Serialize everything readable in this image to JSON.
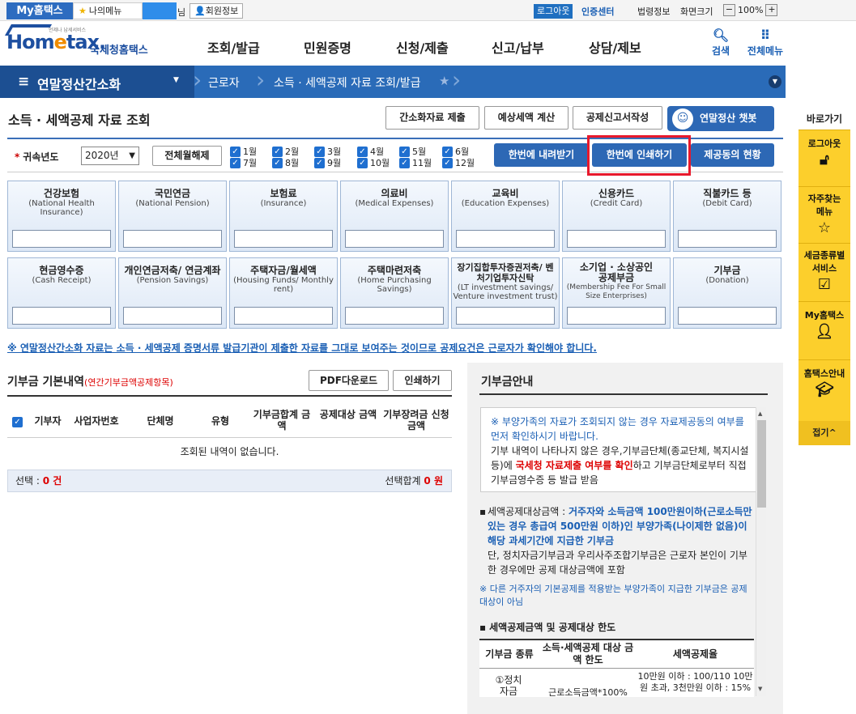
{
  "topbar": {
    "myhome": "My홈택스",
    "mymenu": "나의메뉴",
    "nim": "님",
    "member_info": "회원정보",
    "logout": "로그아웃",
    "cert_center": "인증센터",
    "law_info": "법령정보",
    "screen_size": "화면크기",
    "zoom_minus": "−",
    "zoom": "100%",
    "zoom_plus": "+"
  },
  "logo": {
    "small": "언제나 납세서비스",
    "brand_a": "Hom",
    "brand_b": "e",
    "brand_c": "tax.",
    "brand_kr": "국세청홈택스"
  },
  "gnb": [
    "조회/발급",
    "민원증명",
    "신청/제출",
    "신고/납부",
    "상담/제보"
  ],
  "nav": {
    "search": "검색",
    "all_menu": "전체메뉴"
  },
  "bluebar": {
    "title": "연말정산간소화",
    "crumb1": "근로자",
    "crumb2": "소득 · 세액공제 자료 조회/발급"
  },
  "quick": {
    "title": "바로가기",
    "items": [
      "로그아웃",
      "자주찾는 메뉴",
      "세금종류별 서비스",
      "My홈택스",
      "홈택스안내"
    ],
    "fold": "접기^"
  },
  "page": {
    "title": "소득 · 세액공제 자료 조회",
    "btn_submit": "간소화자료 제출",
    "btn_estimate": "예상세액 계산",
    "btn_report": "공제신고서작성",
    "btn_chatbot": "연말정산 챗봇"
  },
  "filter": {
    "year_label": "귀속년도",
    "required": "*",
    "year_value": "2020년",
    "clear_all": "전체월해제",
    "months": [
      "1월",
      "2월",
      "3월",
      "4월",
      "5월",
      "6월",
      "7월",
      "8월",
      "9월",
      "10월",
      "11월",
      "12월"
    ],
    "download_all": "한번에 내려받기",
    "print_all": "한번에 인쇄하기",
    "agree_status": "제공동의 현황"
  },
  "cards_row1": [
    {
      "kr": "건강보험",
      "en": "(National Health Insurance)"
    },
    {
      "kr": "국민연금",
      "en": "(National Pension)"
    },
    {
      "kr": "보험료",
      "en": "(Insurance)"
    },
    {
      "kr": "의료비",
      "en": "(Medical Expenses)"
    },
    {
      "kr": "교육비",
      "en": "(Education Expenses)"
    },
    {
      "kr": "신용카드",
      "en": "(Credit Card)"
    },
    {
      "kr": "직불카드 등",
      "en": "(Debit Card)"
    }
  ],
  "cards_row2": [
    {
      "kr": "현금영수증",
      "en": "(Cash Receipt)"
    },
    {
      "kr": "개인연금저축/ 연금계좌",
      "en": "(Pension Savings)"
    },
    {
      "kr": "주택자금/월세액",
      "en": "(Housing Funds/ Monthly rent)"
    },
    {
      "kr": "주택마련저축",
      "en": "(Home Purchasing Savings)"
    },
    {
      "kr": "장기집합투자증권저축/ 벤처기업투자신탁",
      "en": "(LT investment savings/ Venture investment trust)"
    },
    {
      "kr": "소기업 · 소상공인 공제부금",
      "en": "(Membership Fee For Small Size Enterprises)"
    },
    {
      "kr": "기부금",
      "en": "(Donation)"
    }
  ],
  "notice": "※ 연말정산간소화 자료는 소득 · 세액공제 증명서류 발급기관이 제출한 자료를 그대로 보여주는 것이므로 공제요건은 근로자가 확인해야 합니다.",
  "donation": {
    "title": "기부금 기본내역",
    "title_sub": "(연간기부금액공제항목)",
    "pdf": "PDF다운로드",
    "print": "인쇄하기",
    "headers": [
      "기부자",
      "사업자번호",
      "단체명",
      "유형",
      "기부금합계 금액",
      "공제대상 금액",
      "기부장려금 신청금액"
    ],
    "empty": "조회된 내역이 없습니다.",
    "select_label": "선택 :",
    "select_value": "0 건",
    "total_label": "선택합계",
    "total_value": "0 원"
  },
  "guide": {
    "title": "기부금안내",
    "box_line1": "※ 부양가족의 자료가 조회되지 않는 경우 자료제공동의 여부를 먼저 확인하시기 바랍니다.",
    "box_line2a": "기부 내역이 나타나지 않은 경우,기부금단체(종교단체, 복지시설 등)에",
    "box_line2b": "국세청 자료제출 여부를 확인",
    "box_line2c": "하고 기부금단체로부터 직접 기부금영수증 등 발급 받음",
    "t1a": "세액공제대상금액 :",
    "t1b": "거주자와 소득금액 100만원이하(근로소득만 있는 경우 총급여 500만원 이하)인 부양가족(나이제한 없음)이 해당 과세기간에 지급한 기부금",
    "t1c": "단, 정치자금기부금과 우리사주조합기부금은 근로자 본인이 기부한 경우에만 공제 대상금액에 포함",
    "t2": "※ 다른 거주자의 기본공제를 적용받는 부양가족이 지급한 기부금은 공제대상이 아님",
    "sub": "세액공제금액 및 공제대상 한도",
    "th1": "기부금 종류",
    "th2": "소득·세액공제 대상 금액 한도",
    "th3": "세액공제율",
    "td1": "①정치 자금",
    "td2": "근로소득금액*100%",
    "td3": "10만원 이하 : 100/110 10만원 초과, 3천만원 이하 : 15%"
  }
}
